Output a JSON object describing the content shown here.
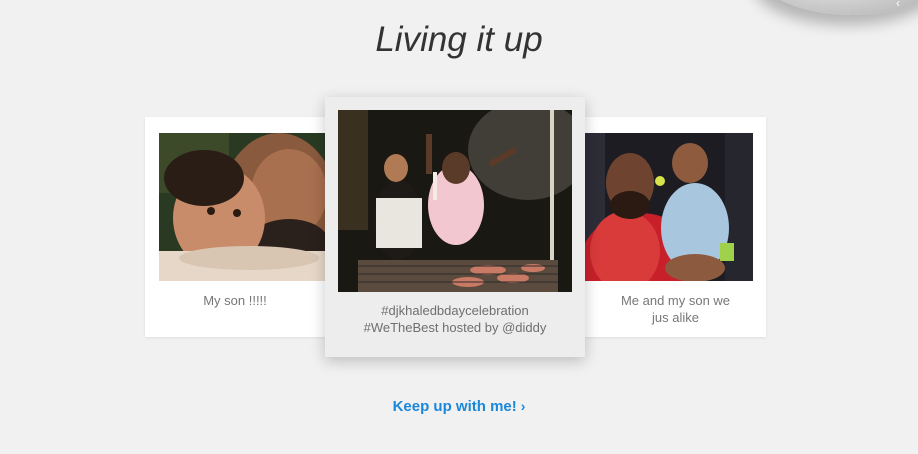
{
  "section": {
    "title": "Living it up"
  },
  "cards": {
    "left": {
      "caption": "My son !!!!!"
    },
    "center": {
      "caption_line1": "#djkhaledbdaycelebration",
      "caption_line2": "#WeTheBest hosted by @diddy"
    },
    "right": {
      "caption_line1": "Me and my son we",
      "caption_line2": "jus alike"
    }
  },
  "cta": {
    "label": "Keep up with me!",
    "icon": "chevron-right-icon",
    "color": "#1b87d8"
  }
}
